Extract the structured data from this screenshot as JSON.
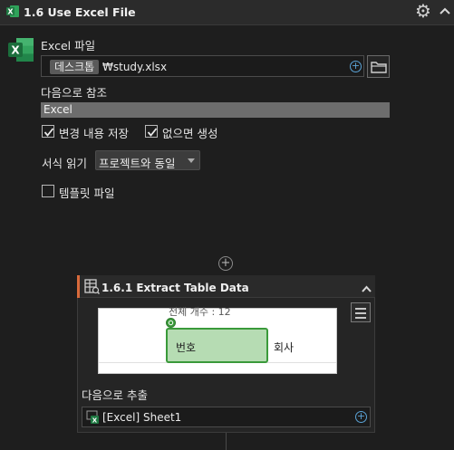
{
  "header": {
    "title": "1.6 Use Excel File",
    "icon": "excel-icon",
    "settings_icon": "gear-icon",
    "collapse_icon": "chevron-up-icon"
  },
  "excel_file": {
    "label": "Excel 파일",
    "path_chip": "데스크톱",
    "path_rest": "₩study.xlsx",
    "add_icon": "plus-circle-icon",
    "browse_icon": "folder-icon"
  },
  "reference": {
    "label": "다음으로 참조",
    "value": "Excel"
  },
  "options": {
    "save_changes": {
      "label": "변경 내용 저장",
      "checked": true
    },
    "create_if_missing": {
      "label": "없으면 생성",
      "checked": true
    },
    "template_file": {
      "label": "템플릿 파일",
      "checked": false
    }
  },
  "format": {
    "label": "서식 읽기",
    "selected": "프로젝트와 동일"
  },
  "sub_activity": {
    "title": "1.6.1 Extract Table Data",
    "icon": "extract-table-icon",
    "collapse_icon": "chevron-up-icon",
    "preview": {
      "count_text": "전체 개수 : 12",
      "selected_cell": "번호",
      "next_cell": "회사"
    },
    "menu_icon": "hamburger-menu-icon",
    "output_label": "다음으로 추출",
    "output_value": "[Excel]  Sheet1",
    "output_add_icon": "plus-circle-icon"
  },
  "colors": {
    "accent_orange": "#d96a3b",
    "excel_green": "#1f7a43",
    "selection_green": "#b6dcb3",
    "link_blue": "#5ba3d6"
  }
}
